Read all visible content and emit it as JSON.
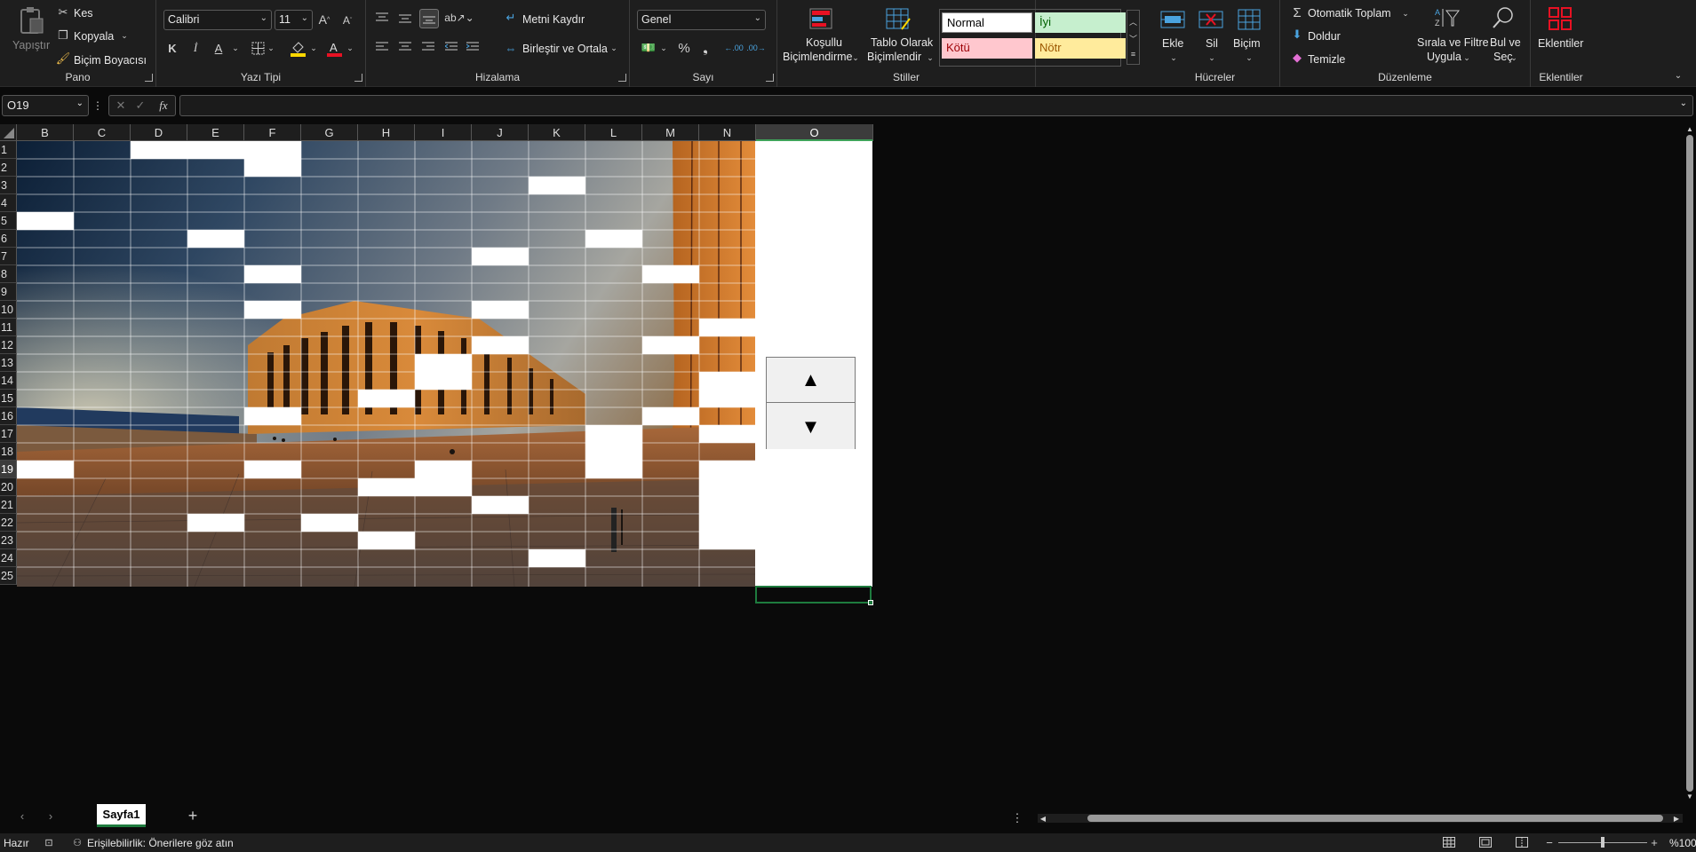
{
  "ribbon": {
    "clipboard": {
      "paste": "Yapıştır",
      "cut": "Kes",
      "copy": "Kopyala",
      "format_painter": "Biçim Boyacısı",
      "label": "Pano"
    },
    "font": {
      "name": "Calibri",
      "size": "11",
      "label": "Yazı Tipi",
      "bold": "K",
      "italic": "İ",
      "underline": "A",
      "font_color": "#e81123",
      "fill_color": "#ffd800"
    },
    "alignment": {
      "wrap": "Metni Kaydır",
      "merge": "Birleştir ve Ortala",
      "label": "Hizalama"
    },
    "number": {
      "format": "Genel",
      "percent": "%",
      "comma": "#",
      "label": "Sayı"
    },
    "styles": {
      "cond_line1": "Koşullu",
      "cond_line2": "Biçimlendirme",
      "table_line1": "Tablo Olarak",
      "table_line2": "Biçimlendir",
      "normal": "Normal",
      "good": "İyi",
      "bad": "Kötü",
      "neutral": "Nötr",
      "label": "Stiller"
    },
    "cells": {
      "insert": "Ekle",
      "delete": "Sil",
      "format": "Biçim",
      "label": "Hücreler"
    },
    "editing": {
      "autosum": "Otomatik Toplam",
      "fill": "Doldur",
      "clear": "Temizle",
      "sort_line1": "Sırala ve Filtre",
      "sort_line2": "Uygula",
      "find_line1": "Bul ve",
      "find_line2": "Seç",
      "label": "Düzenleme"
    },
    "addins": {
      "button": "Eklentiler",
      "label": "Eklentiler"
    }
  },
  "formula_bar": {
    "name_box": "O19",
    "fx": "fx",
    "value": ""
  },
  "sheet": {
    "columns": [
      "B",
      "C",
      "D",
      "E",
      "F",
      "G",
      "H",
      "I",
      "J",
      "K",
      "L",
      "M",
      "N",
      "O"
    ],
    "rows": [
      "1",
      "2",
      "3",
      "4",
      "5",
      "6",
      "7",
      "8",
      "9",
      "10",
      "11",
      "12",
      "13",
      "14",
      "15",
      "16",
      "17",
      "18",
      "19",
      "20",
      "21",
      "22",
      "23",
      "24",
      "25"
    ],
    "selected_column": "O",
    "selected_row": "19",
    "spinner_up": "▲",
    "spinner_down": "▼"
  },
  "tabs": {
    "sheet1": "Sayfa1",
    "add": "+"
  },
  "status": {
    "ready": "Hazır",
    "accessibility": "Erişilebilirlik: Önerilere göz atın",
    "zoom": "%100"
  }
}
